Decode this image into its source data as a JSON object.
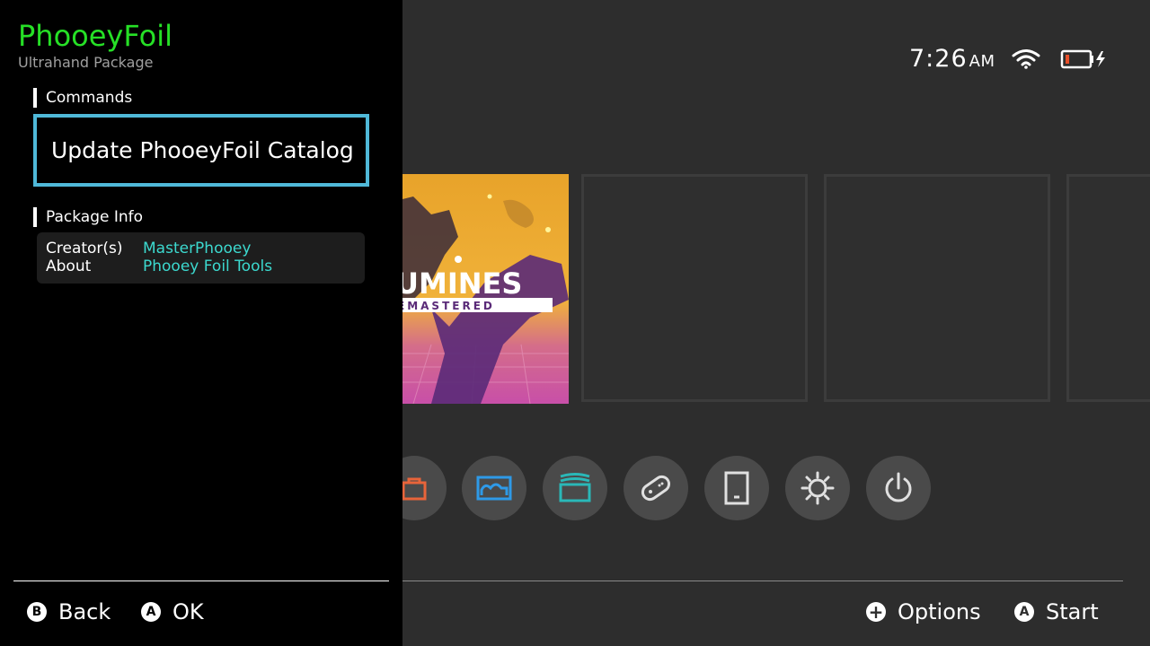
{
  "overlay": {
    "title": "PhooeyFoil",
    "subtitle": "Ultrahand Package",
    "sections": {
      "commands": "Commands",
      "package_info": "Package Info"
    },
    "command_item": "Update PhooeyFoil Catalog",
    "info": [
      {
        "key": "Creator(s)",
        "value": "MasterPhooey"
      },
      {
        "key": "About",
        "value": "Phooey Foil Tools"
      }
    ],
    "footer": {
      "back": {
        "glyph": "B",
        "label": "Back"
      },
      "ok": {
        "glyph": "A",
        "label": "OK"
      }
    },
    "colors": {
      "title": "#26e026",
      "selection_border": "#4fb8d8",
      "info_value": "#3cd9cf"
    }
  },
  "home": {
    "clock": {
      "time": "7:26",
      "ampm": "AM"
    },
    "status_icons": [
      "wifi-icon",
      "battery-charging-icon"
    ],
    "battery_level": 0.12,
    "game_art_text": "UMINES",
    "game_art_subtext": "EMASTERED",
    "dock_icons": [
      "eshop-icon",
      "album-icon",
      "news-icon",
      "controllers-icon",
      "sleep-device-icon",
      "settings-icon",
      "power-icon"
    ],
    "footer": {
      "options": {
        "glyph": "+",
        "label": "Options"
      },
      "start": {
        "glyph": "A",
        "label": "Start"
      }
    }
  }
}
